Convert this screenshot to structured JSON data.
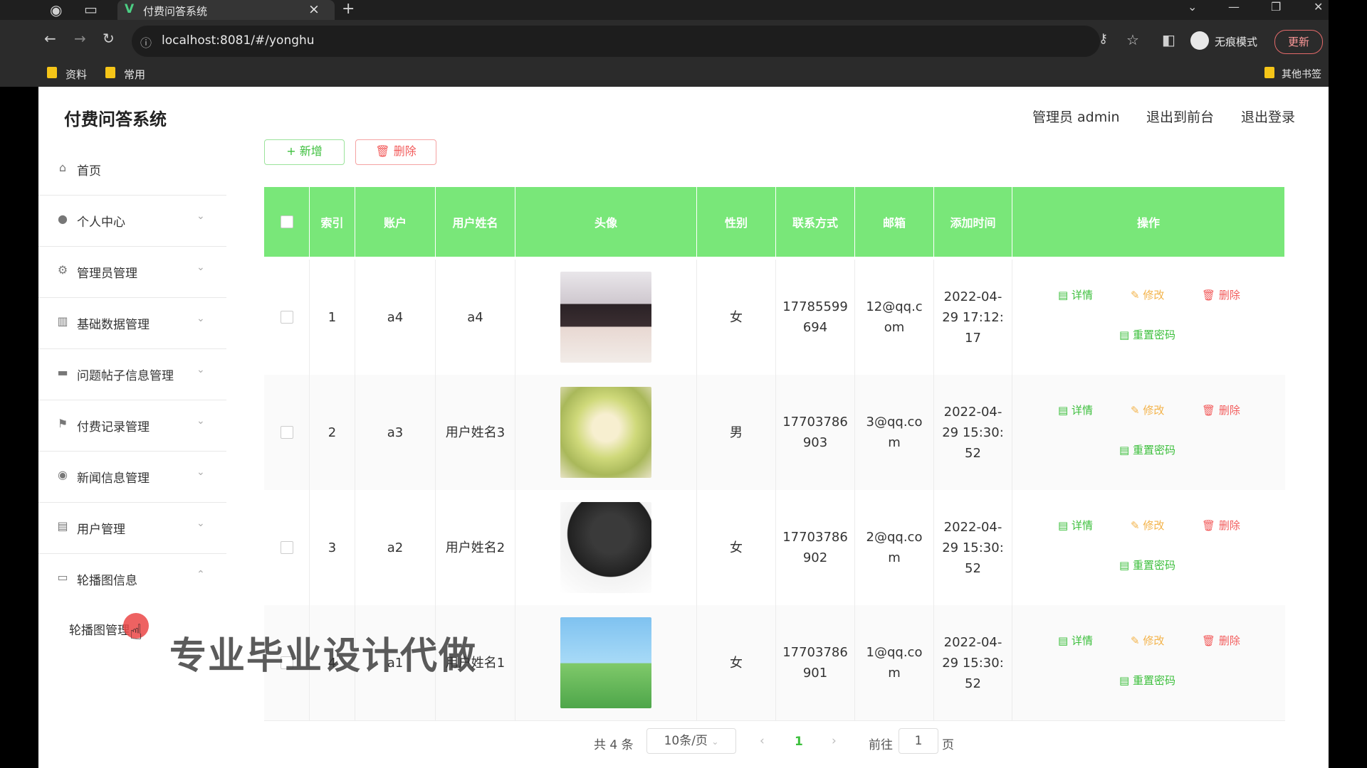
{
  "browser": {
    "tab_title": "付费问答系统",
    "tab_close": "×",
    "new_tab": "+",
    "url": "localhost:8081/#/yonghu",
    "incognito_label": "无痕模式",
    "update_label": "更新",
    "bookmarks": [
      "资料",
      "常用"
    ],
    "other_bookmarks": "其他书签"
  },
  "header": {
    "title": "付费问答系统",
    "admin": "管理员 admin",
    "to_front": "退出到前台",
    "logout": "退出登录"
  },
  "sidebar": {
    "items": [
      {
        "label": "首页",
        "icon": "home-icon",
        "glyph": "⌂"
      },
      {
        "label": "个人中心",
        "icon": "user-icon",
        "glyph": "●"
      },
      {
        "label": "管理员管理",
        "icon": "settings-icon",
        "glyph": "⚙"
      },
      {
        "label": "基础数据管理",
        "icon": "data-icon",
        "glyph": "▥"
      },
      {
        "label": "问题帖子信息管理",
        "icon": "monitor-icon",
        "glyph": "▬"
      },
      {
        "label": "付费记录管理",
        "icon": "flag-icon",
        "glyph": "⚑"
      },
      {
        "label": "新闻信息管理",
        "icon": "news-icon",
        "glyph": "◉"
      },
      {
        "label": "用户管理",
        "icon": "clipboard-icon",
        "glyph": "▤"
      },
      {
        "label": "轮播图信息",
        "icon": "carousel-icon",
        "glyph": "▭"
      }
    ],
    "submenu": "轮播图管理"
  },
  "toolbar": {
    "add": "+ 新增",
    "delete": "删除"
  },
  "table": {
    "headers": [
      "索引",
      "账户",
      "用户姓名",
      "头像",
      "性别",
      "联系方式",
      "邮箱",
      "添加时间",
      "操作"
    ],
    "rows": [
      {
        "index": "1",
        "account": "a4",
        "name": "a4",
        "gender": "女",
        "phone": "17785599\n694",
        "email": "12@qq.c\nom",
        "time": "2022-04-\n29 17:12:\n17"
      },
      {
        "index": "2",
        "account": "a3",
        "name": "用户姓名3",
        "gender": "男",
        "phone": "17703786\n903",
        "email": "3@qq.co\nm",
        "time": "2022-04-\n29 15:30:\n52"
      },
      {
        "index": "3",
        "account": "a2",
        "name": "用户姓名2",
        "gender": "女",
        "phone": "17703786\n902",
        "email": "2@qq.co\nm",
        "time": "2022-04-\n29 15:30:\n52"
      },
      {
        "index": "4",
        "account": "a1",
        "name": "用户姓名1",
        "gender": "女",
        "phone": "17703786\n901",
        "email": "1@qq.co\nm",
        "time": "2022-04-\n29 15:30:\n52"
      }
    ],
    "ops": {
      "detail": "详情",
      "edit": "修改",
      "delete": "删除",
      "reset": "重置密码"
    }
  },
  "pagination": {
    "total": "共 4 条",
    "page_size": "10条/页",
    "current": "1",
    "goto_label": "前往",
    "goto_value": "1",
    "page_suffix": "页"
  },
  "overlay": {
    "watermark": "专业毕业设计代做"
  },
  "colors": {
    "header_green": "#79e779",
    "accent_green": "#3cbf3c",
    "edit_orange": "#f3b34a",
    "delete_red": "#f25b5b"
  }
}
